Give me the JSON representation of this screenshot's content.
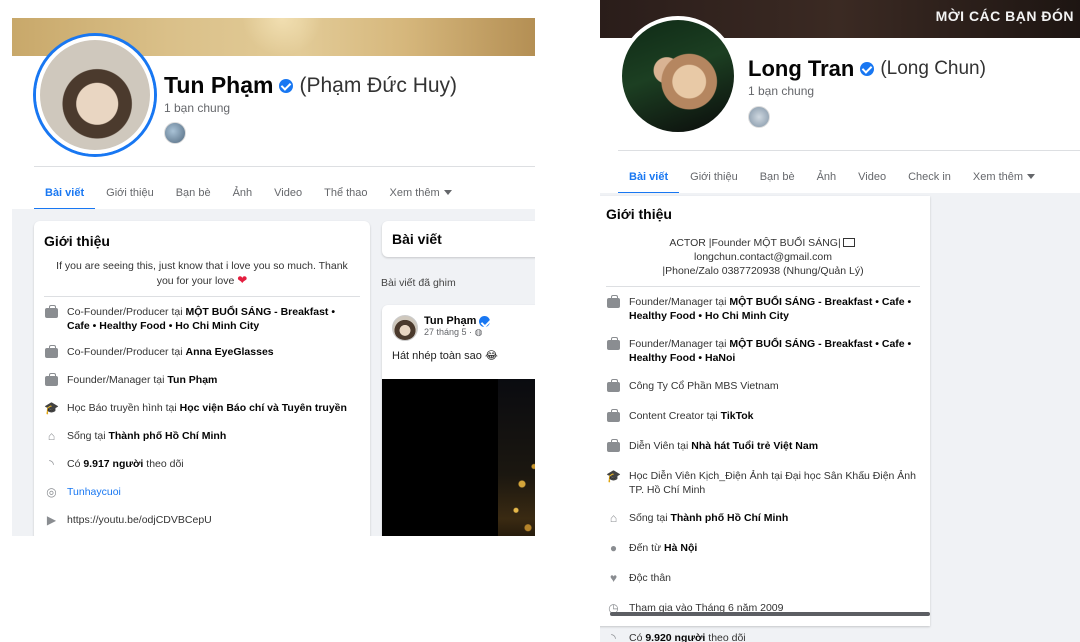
{
  "left": {
    "name": "Tun Phạm",
    "alt_name": "(Phạm Đức Huy)",
    "mutual": "1 bạn chung",
    "tabs": [
      {
        "label": "Bài viết"
      },
      {
        "label": "Giới thiệu"
      },
      {
        "label": "Bạn bè"
      },
      {
        "label": "Ảnh"
      },
      {
        "label": "Video"
      },
      {
        "label": "Thể thao"
      },
      {
        "label": "Xem thêm"
      }
    ],
    "intro_title": "Giới thiệu",
    "bio": "If you are seeing this, just know that i love you so much. Thank you for your love",
    "items": [
      {
        "icon": "briefcase-icon",
        "prefix": "Co-Founder/Producer tại ",
        "bold": "MỘT BUỔI SÁNG - Breakfast • Cafe • Healthy Food • Ho Chi Minh City"
      },
      {
        "icon": "briefcase-icon",
        "prefix": "Co-Founder/Producer tại ",
        "bold": "Anna EyeGlasses"
      },
      {
        "icon": "briefcase-icon",
        "prefix": "Founder/Manager tại ",
        "bold": "Tun Phạm"
      },
      {
        "icon": "graduation-cap-icon",
        "prefix": "Học Báo truyền hình tại ",
        "bold": "Học viện Báo chí và Tuyên truyền"
      },
      {
        "icon": "home-icon",
        "prefix": "Sống tại ",
        "bold": "Thành phố Hồ Chí Minh"
      },
      {
        "icon": "rss-icon",
        "prefix": "Có ",
        "bold": "9.917 người",
        "suffix": " theo dõi"
      }
    ],
    "instagram": "Tunhaycuoi",
    "youtube": "https://youtu.be/odjCDVBCepU",
    "posts_title": "Bài viết",
    "pinned_label": "Bài viết đã ghim",
    "post": {
      "author": "Tun Phạm",
      "date": "27 tháng 5 ·",
      "text": "Hát nhép toàn sao 😂"
    }
  },
  "right": {
    "cover_text": "MỜI CÁC BẠN ĐÓN",
    "name": "Long Tran",
    "alt_name": "(Long Chun)",
    "mutual": "1 bạn chung",
    "tabs": [
      {
        "label": "Bài viết"
      },
      {
        "label": "Giới thiệu"
      },
      {
        "label": "Bạn bè"
      },
      {
        "label": "Ảnh"
      },
      {
        "label": "Video"
      },
      {
        "label": "Check in"
      },
      {
        "label": "Xem thêm"
      }
    ],
    "intro_title": "Giới thiệu",
    "bio_line1_a": "ACTOR |Founder MỘT BUỔI SÁNG|",
    "bio_line1_b": " longchun.contact@gmail.com",
    "bio_line2": "|Phone/Zalo 0387720938 (Nhung/Quản Lý)",
    "items": [
      {
        "icon": "briefcase-icon",
        "prefix": "Founder/Manager tại ",
        "bold": "MỘT BUỔI SÁNG - Breakfast • Cafe • Healthy Food • Ho Chi Minh City"
      },
      {
        "icon": "briefcase-icon",
        "prefix": "Founder/Manager tại ",
        "bold": "MỘT BUỔI SÁNG - Breakfast • Cafe • Healthy Food • HaNoi"
      },
      {
        "icon": "briefcase-icon",
        "prefix": "Công Ty Cổ Phần MBS Vietnam",
        "bold": ""
      },
      {
        "icon": "briefcase-icon",
        "prefix": "Content Creator tại ",
        "bold": "TikTok"
      },
      {
        "icon": "briefcase-icon",
        "prefix": "Diễn Viên tại ",
        "bold": "Nhà hát Tuổi trẻ Việt Nam"
      },
      {
        "icon": "graduation-cap-icon",
        "prefix": "Học Diễn Viên Kịch_Điện Ảnh tại Đại học Sân Khấu Điện Ảnh TP. Hồ Chí Minh",
        "bold": ""
      },
      {
        "icon": "home-icon",
        "prefix": "Sống tại ",
        "bold": "Thành phố Hồ Chí Minh"
      },
      {
        "icon": "location-pin-icon",
        "prefix": "Đến từ ",
        "bold": "Hà Nội"
      },
      {
        "icon": "heart-icon",
        "prefix": "Độc thân",
        "bold": ""
      },
      {
        "icon": "clock-icon",
        "prefix": "Tham gia vào Tháng 6 năm 2009",
        "bold": ""
      },
      {
        "icon": "rss-icon",
        "prefix": "Có ",
        "bold": "9.920 người",
        "suffix": " theo dõi"
      }
    ]
  },
  "colors": {
    "accent": "#1877f2",
    "background": "#f0f2f5",
    "muted_text": "#65676b",
    "heart": "#e41e3f"
  }
}
